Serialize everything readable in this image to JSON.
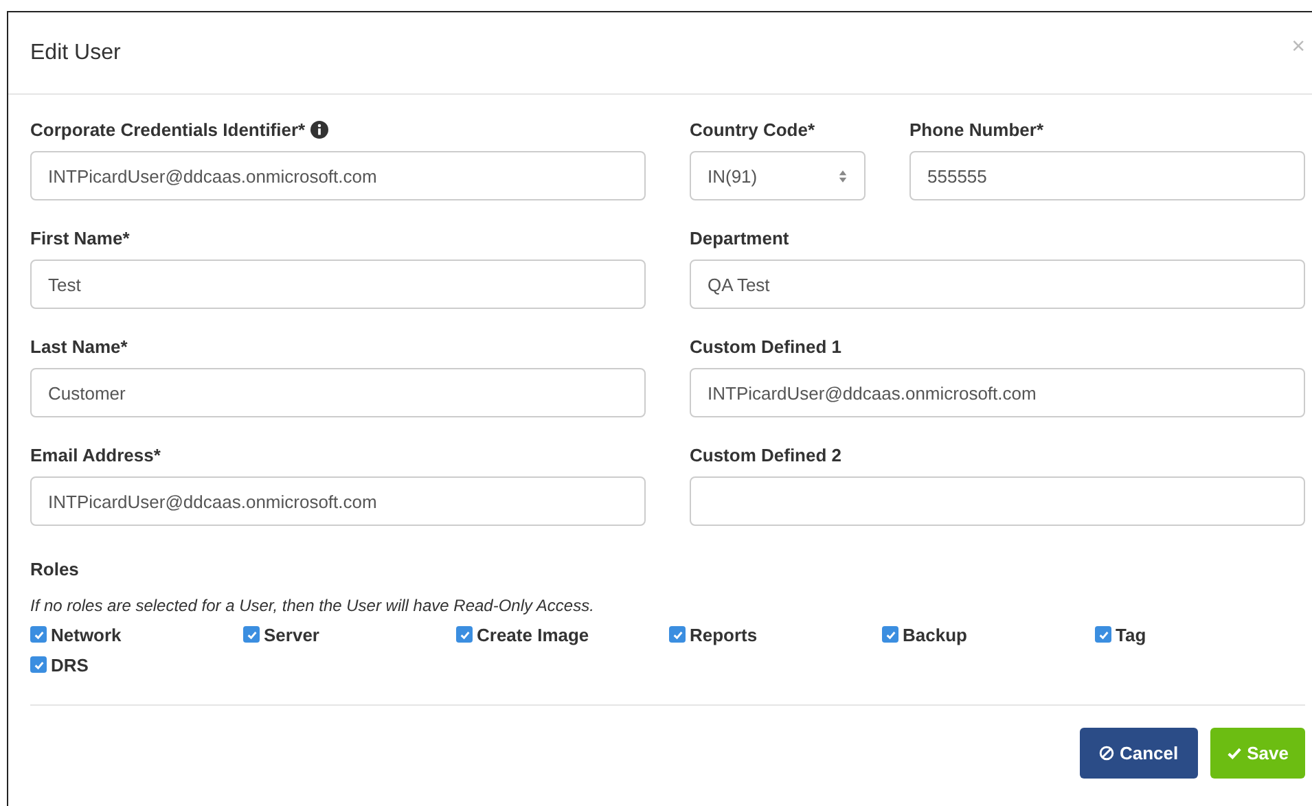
{
  "dialog": {
    "title": "Edit User",
    "close": "×"
  },
  "rows": [
    {
      "left": {
        "kind": "text",
        "label": "Corporate Credentials Identifier*",
        "info": true,
        "value": "INTPicardUser@ddcaas.onmicrosoft.com"
      },
      "right": [
        {
          "kind": "select",
          "label": "Country Code*",
          "value": "IN(91)"
        },
        {
          "kind": "text",
          "label": "Phone Number*",
          "value": "555555"
        }
      ]
    },
    {
      "left": {
        "kind": "text",
        "label": "First Name*",
        "value": "Test"
      },
      "right": [
        {
          "kind": "text",
          "label": "Department",
          "value": "QA Test"
        }
      ]
    },
    {
      "left": {
        "kind": "text",
        "label": "Last Name*",
        "value": "Customer"
      },
      "right": [
        {
          "kind": "text",
          "label": "Custom Defined 1",
          "value": "INTPicardUser@ddcaas.onmicrosoft.com"
        }
      ]
    },
    {
      "left": {
        "kind": "text",
        "label": "Email Address*",
        "value": "INTPicardUser@ddcaas.onmicrosoft.com"
      },
      "right": [
        {
          "kind": "text",
          "label": "Custom Defined 2"
        }
      ]
    }
  ],
  "roles": {
    "title": "Roles",
    "note": "If no roles are selected for a User, then the User will have Read-Only Access.",
    "items": [
      {
        "label": "Network",
        "checked": true
      },
      {
        "label": "Server",
        "checked": true
      },
      {
        "label": "Create Image",
        "checked": true
      },
      {
        "label": "Reports",
        "checked": true
      },
      {
        "label": "Backup",
        "checked": true
      },
      {
        "label": "Tag",
        "checked": true
      },
      {
        "label": "DRS",
        "checked": true
      }
    ]
  },
  "buttons": [
    {
      "kind": "cancel",
      "label": "Cancel"
    },
    {
      "kind": "save",
      "label": "Save"
    }
  ]
}
